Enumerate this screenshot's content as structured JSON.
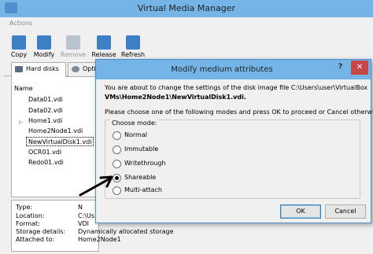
{
  "main_window": {
    "title": "Virtual Media Manager",
    "actions_label": "Actions",
    "toolbar": [
      {
        "label": "Copy",
        "icon": "copy-icon",
        "enabled": true
      },
      {
        "label": "Modify",
        "icon": "modify-icon",
        "enabled": true
      },
      {
        "label": "Remove",
        "icon": "remove-icon",
        "enabled": false
      },
      {
        "label": "Release",
        "icon": "release-icon",
        "enabled": true
      },
      {
        "label": "Refresh",
        "icon": "refresh-icon",
        "enabled": true
      }
    ],
    "tabs": [
      {
        "label": "Hard disks",
        "icon": "hard-disk-icon",
        "selected": true
      },
      {
        "label": "Optic",
        "icon": "optical-disk-icon",
        "selected": false
      }
    ],
    "list": {
      "column_name": "Name",
      "items": [
        {
          "label": "Data01.vdi"
        },
        {
          "label": "Data02.vdi"
        },
        {
          "label": "Home1.vdi",
          "expandable": true
        },
        {
          "label": "Home2Node1.vdi"
        },
        {
          "label": "NewVirtualDisk1.vdi",
          "selected": true
        },
        {
          "label": "OCR01.vdi"
        },
        {
          "label": "Redo01.vdi"
        }
      ]
    },
    "details": [
      {
        "key": "Type:",
        "value": "N"
      },
      {
        "key": "Location:",
        "value": "C:\\Us"
      },
      {
        "key": "Format:",
        "value": "VDI"
      },
      {
        "key": "Storage details:",
        "value": "Dynamically allocated storage"
      },
      {
        "key": "Attached to:",
        "value": "Home2Node1"
      }
    ]
  },
  "dialog": {
    "title": "Modify medium attributes",
    "help": "?",
    "close": "✕",
    "message_line1": "You are about to change the settings of the disk image file C:\\Users\\user\\VirtualBox",
    "message_line2": "VMs\\Home2Node1\\NewVirtualDisk1.vdi.",
    "message2": "Please choose one of the following modes and press OK to proceed or Cancel otherwise.",
    "mode_group_title": "Choose mode:",
    "modes": [
      {
        "label": "Normal",
        "checked": false
      },
      {
        "label": "Immutable",
        "checked": false
      },
      {
        "label": "Writethrough",
        "checked": false
      },
      {
        "label": "Shareable",
        "checked": true
      },
      {
        "label": "Multi-attach",
        "checked": false
      }
    ],
    "ok_label": "OK",
    "cancel_label": "Cancel"
  },
  "colors": {
    "title_bar": "#74b4e7",
    "close_button": "#c74646",
    "window_bg": "#f0f0f0",
    "arrow": "#000000"
  }
}
